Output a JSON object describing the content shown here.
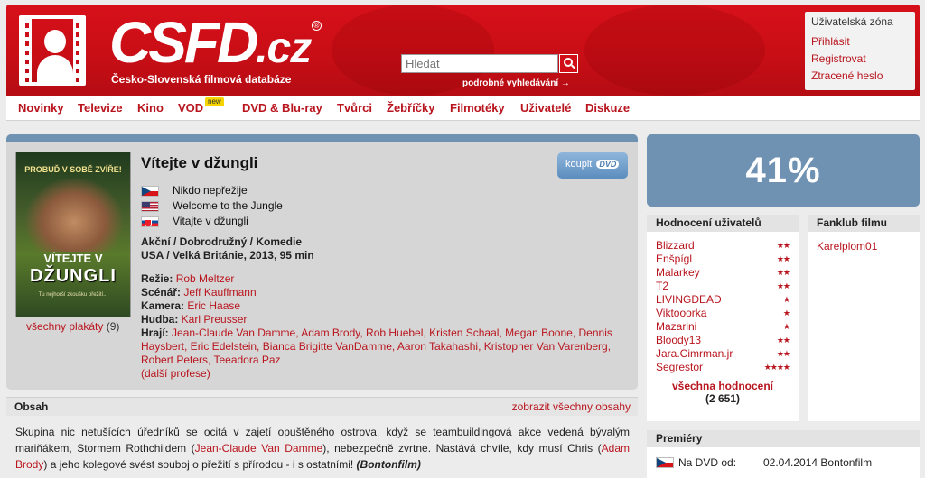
{
  "header": {
    "logo_text": "CSFD",
    "logo_domain": ".cz",
    "registered": "®",
    "tagline": "Česko-Slovenská filmová databáze",
    "search_placeholder": "Hledat",
    "advanced_search": "podrobné vyhledávání →"
  },
  "userzone": {
    "title": "Uživatelská zóna",
    "login": "Přihlásit",
    "register": "Registrovat",
    "lost_password": "Ztracené heslo"
  },
  "nav": {
    "items": [
      "Novinky",
      "Televize",
      "Kino",
      "VOD",
      "DVD & Blu-ray",
      "Tvůrci",
      "Žebříčky",
      "Filmotéky",
      "Uživatelé",
      "Diskuze"
    ],
    "vod_badge": "new"
  },
  "film": {
    "title": "Vítejte v džungli",
    "buy_label": "koupit",
    "buy_badge": "DVD",
    "alt_names": [
      {
        "flag": "cz",
        "name": "Nikdo nepřežije"
      },
      {
        "flag": "us",
        "name": "Welcome to the Jungle"
      },
      {
        "flag": "sk",
        "name": "Vitajte v džungli"
      }
    ],
    "genres": "Akční / Dobrodružný / Komedie",
    "origin": "USA / Velká Británie, 2013, 95 min",
    "director_label": "Režie:",
    "director": "Rob Meltzer",
    "writer_label": "Scénář:",
    "writer": "Jeff Kauffmann",
    "camera_label": "Kamera:",
    "camera": "Eric Haase",
    "music_label": "Hudba:",
    "music": "Karl Preusser",
    "cast_label": "Hrají:",
    "cast": "Jean-Claude Van Damme, Adam Brody, Rob Huebel, Kristen Schaal, Megan Boone, Dennis Haysbert, Eric Edelstein, Bianca Brigitte VanDamme, Aaron Takahashi, Kristopher Van Varenberg, Robert Peters, Teeadora Paz",
    "more_professions": "(další profese)",
    "all_posters": "všechny plakáty",
    "posters_count": "(9)",
    "poster": {
      "tagline": "PROBUĎ V SOBĚ ZVÍŘE!",
      "title_line1": "VÍTEJTE V",
      "title_line2": "DŽUNGLI",
      "small_text": "Tu nejhorší zkoušku přežití..."
    }
  },
  "summary": {
    "title": "Obsah",
    "show_all": "zobrazit všechny obsahy",
    "text_part1": "Skupina nic netušících úředníků se ocitá v zajetí opuštěného ostrova, když se teambuildingová akce vedená bývalým mariňákem, Stormem Rothchildem (",
    "actor1": "Jean-Claude Van Damme",
    "text_part2": "), nebezpečně zvrtne. Nastává chvíle, kdy musí Chris (",
    "actor2": "Adam Brody",
    "text_part3": ") a jeho kolegové svést souboj o přežití s přírodou - i s ostatními!",
    "source": "(Bontonfilm)"
  },
  "rating": {
    "value": "41%",
    "accent_color": "#6f92b3"
  },
  "user_ratings": {
    "title": "Hodnocení uživatelů",
    "items": [
      {
        "user": "Blizzard",
        "stars": 2
      },
      {
        "user": "Enšpígl",
        "stars": 2
      },
      {
        "user": "Malarkey",
        "stars": 2
      },
      {
        "user": "T2",
        "stars": 2
      },
      {
        "user": "LIVINGDEAD",
        "stars": 1
      },
      {
        "user": "Viktooorka",
        "stars": 1
      },
      {
        "user": "Mazarini",
        "stars": 1
      },
      {
        "user": "Bloody13",
        "stars": 2
      },
      {
        "user": "Jara.Cimrman.jr",
        "stars": 2
      },
      {
        "user": "Segrestor",
        "stars": 4
      }
    ],
    "all_ratings": "všechna hodnocení",
    "count": "(2 651)"
  },
  "fanclub": {
    "title": "Fanklub filmu",
    "members": [
      "Karelplom01"
    ]
  },
  "premieres": {
    "title": "Premiéry",
    "items": [
      {
        "flag": "cz",
        "label": "Na DVD od:",
        "date": "02.04.2014 Bontonfilm"
      }
    ]
  }
}
